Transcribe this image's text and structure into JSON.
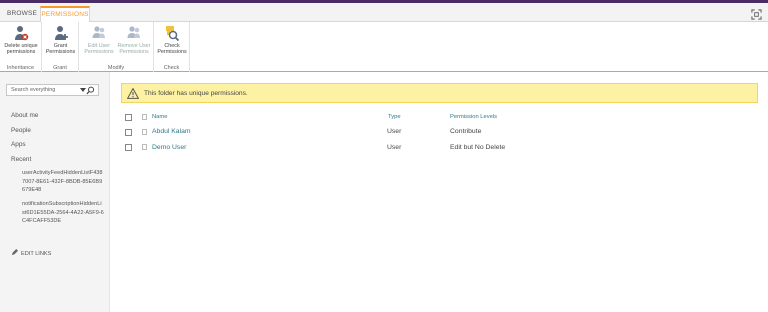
{
  "tabs": {
    "browse": "BROWSE",
    "permissions": "PERMISSIONS"
  },
  "ribbon": {
    "groups": [
      {
        "label": "Inheritance",
        "buttons": [
          {
            "label_line1": "Delete unique",
            "label_line2": "permissions"
          }
        ]
      },
      {
        "label": "Grant",
        "buttons": [
          {
            "label_line1": "Grant",
            "label_line2": "Permissions"
          }
        ]
      },
      {
        "label": "Modify",
        "buttons": [
          {
            "label_line1": "Edit User",
            "label_line2": "Permissions"
          },
          {
            "label_line1": "Remove User",
            "label_line2": "Permissions"
          }
        ]
      },
      {
        "label": "Check",
        "buttons": [
          {
            "label_line1": "Check",
            "label_line2": "Permissions"
          }
        ]
      }
    ]
  },
  "sidebar": {
    "search_placeholder": "Search everything",
    "nav": [
      "About me",
      "People",
      "Apps",
      "Recent"
    ],
    "recent": [
      "userActivityFeedHiddenListF4387007-8E61-432F-8BDB-85E6B9679E48",
      "notificationSubscriptionHiddenList6D1E55DA-2564-4A22-A5F9-6C4FCAFF53DE"
    ],
    "edit_links": "EDIT LINKS"
  },
  "notice": {
    "text": "This folder has unique permissions."
  },
  "table": {
    "headers": {
      "name": "Name",
      "type": "Type",
      "levels": "Permission Levels"
    },
    "rows": [
      {
        "name": "Abdul Kalam",
        "type": "User",
        "levels": "Contribute"
      },
      {
        "name": "Demo User",
        "type": "User",
        "levels": "Edit but No Delete"
      }
    ]
  },
  "colors": {
    "accent": "#f49b2e",
    "suite_bar": "#4a2b68",
    "link": "#2b7a8a",
    "notice_bg": "#fdf2a3"
  }
}
